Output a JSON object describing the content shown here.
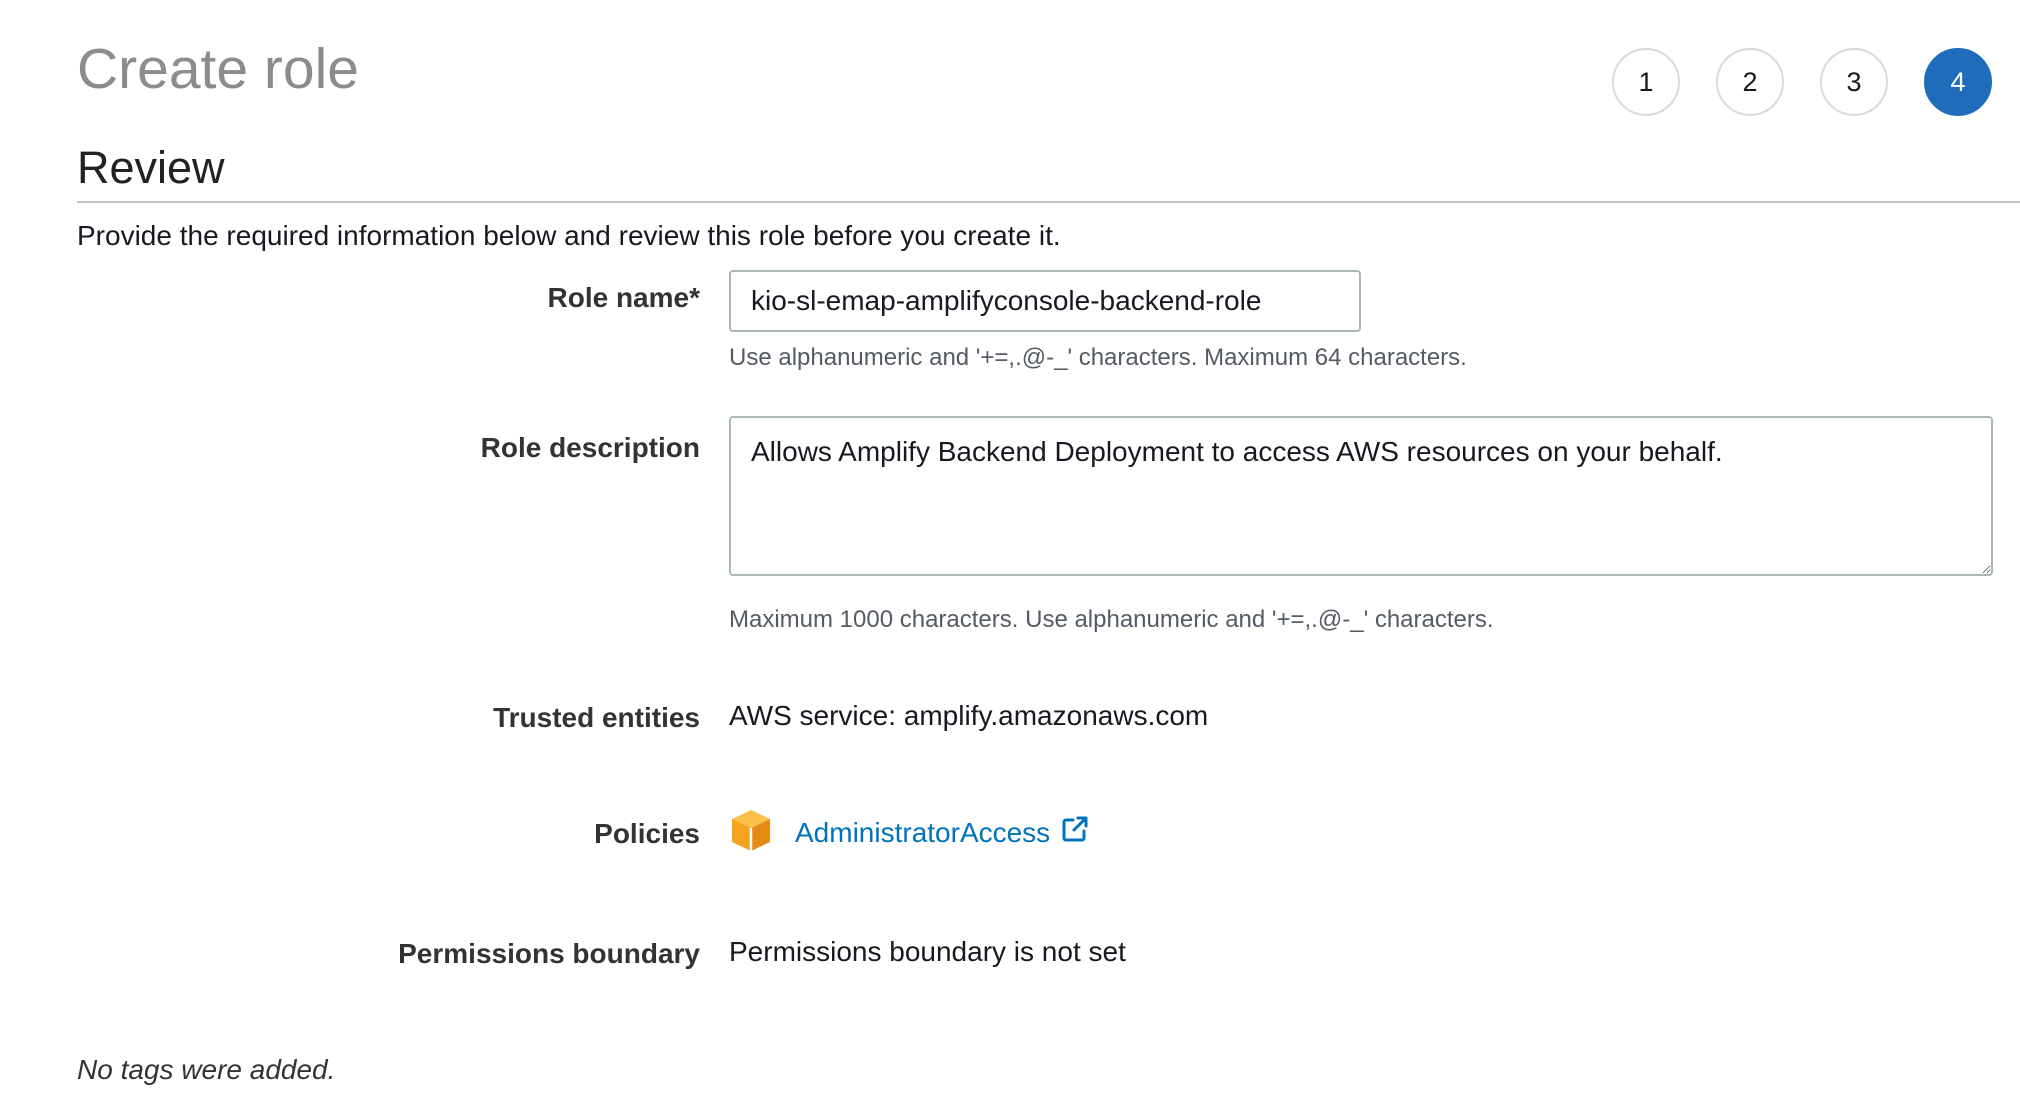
{
  "header": {
    "title": "Create role",
    "steps": [
      "1",
      "2",
      "3",
      "4"
    ],
    "active_step": "4"
  },
  "review": {
    "subtitle": "Review",
    "intro": "Provide the required information below and review this role before you create it."
  },
  "role_name": {
    "label": "Role name*",
    "value": "kio-sl-emap-amplifyconsole-backend-role",
    "hint": "Use alphanumeric and '+=,.@-_' characters. Maximum 64 characters."
  },
  "role_description": {
    "label": "Role description",
    "value": "Allows Amplify Backend Deployment to access AWS resources on your behalf.",
    "hint": "Maximum 1000 characters. Use alphanumeric and '+=,.@-_' characters."
  },
  "trusted_entities": {
    "label": "Trusted entities",
    "value": "AWS service: amplify.amazonaws.com"
  },
  "policies": {
    "label": "Policies",
    "items": [
      {
        "name": "AdministratorAccess",
        "icon": "aws-managed-policy-cube-icon"
      }
    ],
    "link_icon": "external-link-icon"
  },
  "permissions_boundary": {
    "label": "Permissions boundary",
    "value": "Permissions boundary is not set"
  },
  "tags": {
    "message": "No tags were added."
  },
  "colors": {
    "active_step": "#1f6cba",
    "link": "#0073bb",
    "policy_icon": "#f7a21c"
  }
}
